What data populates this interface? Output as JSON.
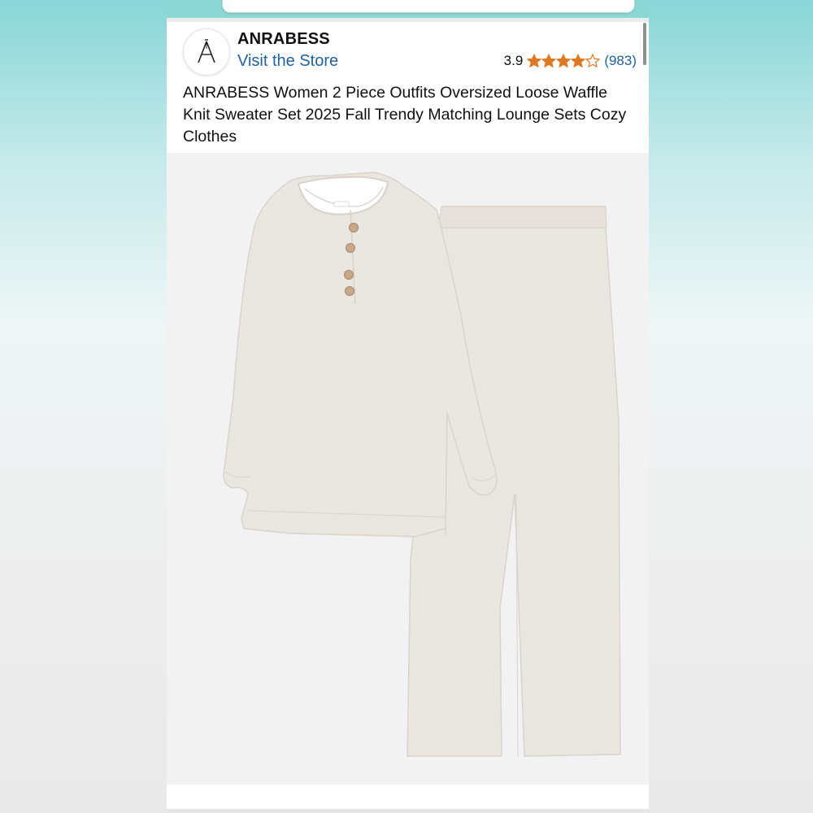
{
  "store": {
    "brand_name": "ANRABESS",
    "visit_store_label": "Visit the Store",
    "logo_icon": "anrabess-a-logo-icon"
  },
  "rating": {
    "value": "3.9",
    "stars_out_of_5": 3.9,
    "review_count": "(983)",
    "star_color": "#de7921"
  },
  "product": {
    "title": "ANRABESS Women 2 Piece Outfits Oversized Loose Waffle Knit Sweater Set 2025 Fall Trendy Matching Lounge Sets Cozy Clothes",
    "image": "product-photo",
    "garment_color": "#ece8e3"
  },
  "colors": {
    "accent_link": "#2162a1",
    "header_strip": "#8ad7d3"
  }
}
